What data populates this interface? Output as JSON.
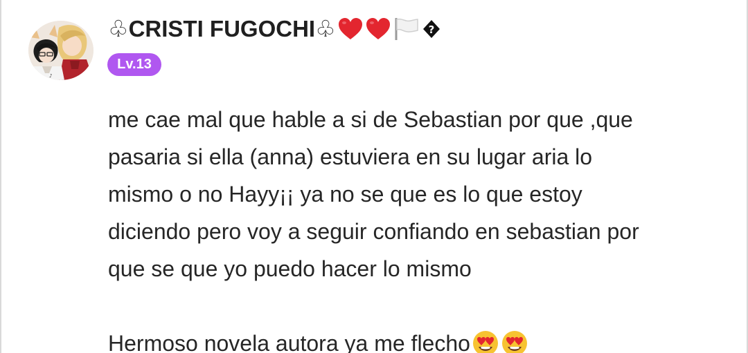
{
  "user": {
    "name": "♧CRISTI FUGOCHI♧",
    "level": "Lv.13",
    "decorations": [
      "heart-icon",
      "heart-icon",
      "white-flag-icon",
      "unknown-glyph-icon"
    ]
  },
  "comment": {
    "paragraph1": "me cae mal que hable a si de Sebastian por que ,que\npasaria si ella (anna) estuviera en su lugar  aria lo\nmismo o no Hayy¡¡ ya no se que es lo que estoy\ndiciendo pero voy a seguir confiando en sebastian por\nque se que yo puedo hacer lo mismo",
    "paragraph2": "Hermoso novela autora ya me flecho",
    "emojis": [
      "heart-eyes-emoji",
      "heart-eyes-emoji"
    ]
  },
  "colors": {
    "level_badge": "#b057f0",
    "heart": "#e3262f",
    "text": "#262626"
  }
}
